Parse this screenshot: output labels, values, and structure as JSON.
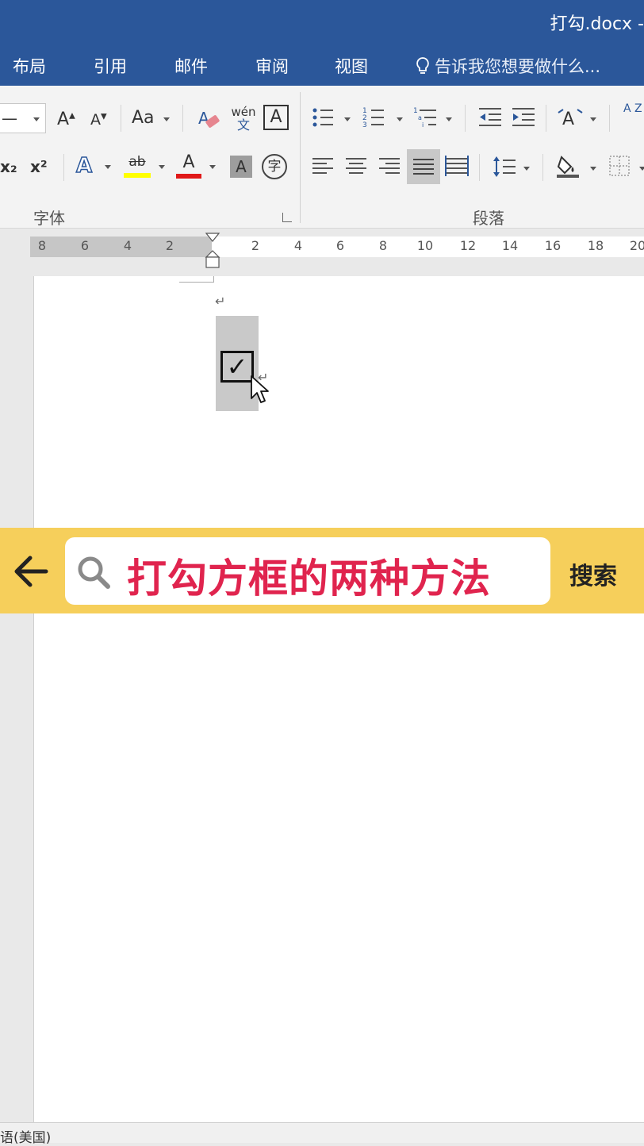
{
  "window": {
    "title": "打勾.docx -"
  },
  "tabs": [
    {
      "label": "布局"
    },
    {
      "label": "引用"
    },
    {
      "label": "邮件"
    },
    {
      "label": "审阅"
    },
    {
      "label": "视图"
    }
  ],
  "tell_me": {
    "text": "告诉我您想要做什么..."
  },
  "ribbon": {
    "font_group": {
      "label": "字体",
      "size_value": "—",
      "change_case_label": "Aa",
      "phonetic_label": "wén",
      "phonetic_sub": "文",
      "border_char": "A",
      "enclose_char": "字",
      "subscript": "x₂",
      "superscript": "x²",
      "grow_font": "A",
      "shrink_font": "A",
      "effects_char": "A",
      "highlight_char": "ab",
      "font_color_char": "A",
      "shading_char": "A"
    },
    "paragraph_group": {
      "label": "段落"
    },
    "sort_label": "A Z"
  },
  "ruler": {
    "ticks": [
      "8",
      "6",
      "4",
      "2",
      "2",
      "4",
      "6",
      "8",
      "10",
      "12",
      "14",
      "16",
      "18",
      "20"
    ]
  },
  "document": {
    "paragraph_mark": "↵",
    "checkbox_char": "✓",
    "checkbox_para_mark": "↵"
  },
  "search_overlay": {
    "query": "打勾方框的两种方法",
    "button_label": "搜索"
  },
  "status": {
    "language": "语(美国)"
  },
  "colors": {
    "accent": "#2b579a",
    "search_bar": "#f6cf5b",
    "query_text": "#e0244e"
  }
}
